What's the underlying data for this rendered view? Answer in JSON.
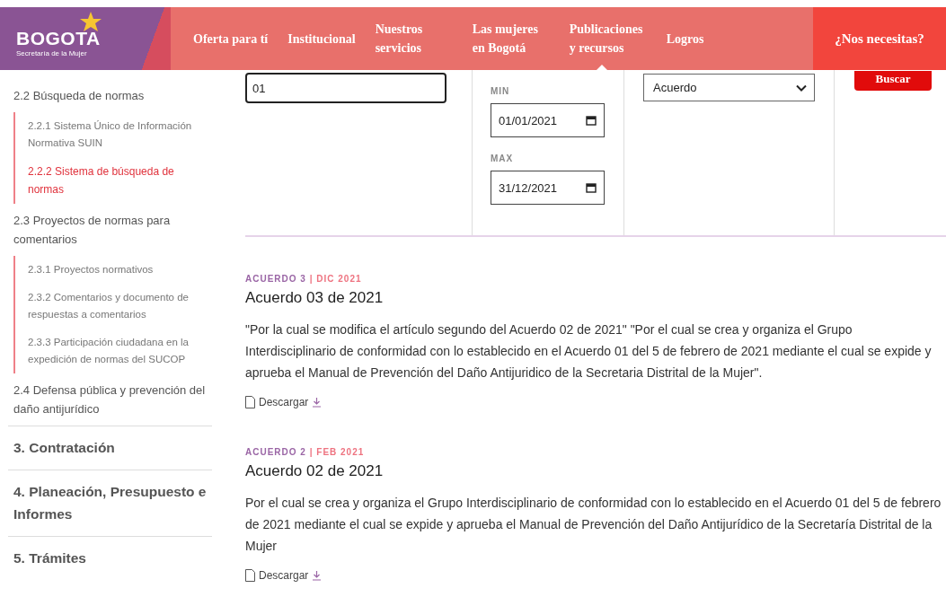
{
  "header": {
    "logo": {
      "name": "BOGOTA",
      "subtitle": "Secretaría de la Mujer"
    },
    "nav": [
      {
        "label": "Oferta para tí",
        "selected": false
      },
      {
        "label": "Institucional",
        "selected": false
      },
      {
        "label": "Nuestros servicios",
        "selected": false
      },
      {
        "label": "Las mujeres en Bogotá",
        "selected": false
      },
      {
        "label": "Publicaciones y recursos",
        "selected": true
      },
      {
        "label": "Logros",
        "selected": false
      }
    ],
    "help_button": "¿Nos necesitas?"
  },
  "sidebar": {
    "items": [
      {
        "kind": "subsection",
        "label": "2.2 Búsqueda de normas",
        "selected": false,
        "children": [
          {
            "label": "2.2.1 Sistema Único de Información Normativa SUIN",
            "selected": false
          },
          {
            "label": "2.2.2 Sistema de búsqueda de normas",
            "selected": true
          }
        ]
      },
      {
        "kind": "subsection",
        "label": "2.3 Proyectos de normas para comentarios",
        "selected": false,
        "children": [
          {
            "label": "2.3.1 Proyectos normativos",
            "selected": false
          },
          {
            "label": "2.3.2 Comentarios y documento de respuestas a comentarios",
            "selected": false
          },
          {
            "label": "2.3.3 Participación ciudadana en la expedición de normas del SUCOP",
            "selected": false
          }
        ]
      },
      {
        "kind": "subsection",
        "label": "2.4 Defensa pública y prevención del daño antijurídico",
        "selected": false
      },
      {
        "kind": "section",
        "label": "3. Contratación",
        "selected": false
      },
      {
        "kind": "section",
        "label": "4. Planeación, Presupuesto e Informes",
        "selected": false
      },
      {
        "kind": "section",
        "label": "5. Trámites",
        "selected": false
      }
    ]
  },
  "filters": {
    "number": {
      "value": "01"
    },
    "date_min": {
      "label": "MIN",
      "value": "01/01/2021"
    },
    "date_max": {
      "label": "MAX",
      "value": "31/12/2021"
    },
    "type": {
      "value": "Acuerdo"
    },
    "search_button": "Buscar"
  },
  "results": [
    {
      "type": "ACUERDO 3",
      "separator": "|",
      "date": "DIC 2021",
      "title": "Acuerdo 03 de 2021",
      "description": "\"Por la cual se modifica el artículo segundo del Acuerdo 02 de 2021\" \"Por el cual se crea y organiza el Grupo Interdisciplinario de conformidad con lo establecido en el Acuerdo 01 del 5 de febrero de 2021 mediante el cual se expide y aprueba el Manual de Prevención del Daño Antijuridico de la Secretaria Distrital de la Mujer\".",
      "download": "Descargar"
    },
    {
      "type": "ACUERDO 2",
      "separator": "|",
      "date": "FEB 2021",
      "title": "Acuerdo 02 de 2021",
      "description": "Por el cual se crea y organiza el Grupo Interdisciplinario de conformidad con lo establecido en el Acuerdo 01 del 5 de febrero de 2021 mediante el cual se expide y aprueba el Manual de Prevención del Daño Antijurídico de la Secretaría Distrital de la Mujer",
      "download": "Descargar"
    }
  ]
}
